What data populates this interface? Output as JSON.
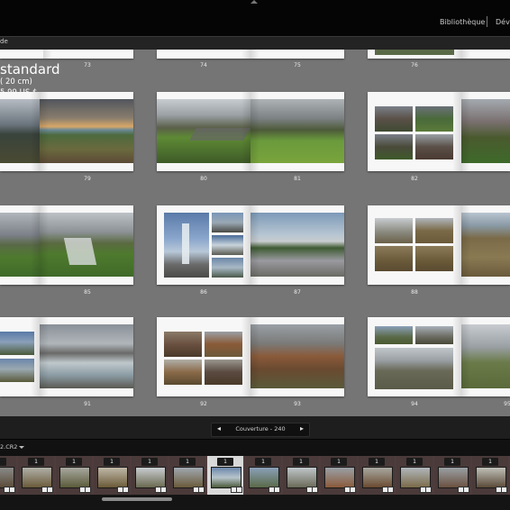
{
  "header": {
    "modules": [
      {
        "label": "Bibliothèque"
      },
      {
        "label": "Dév"
      }
    ]
  },
  "panel": {
    "label": "de"
  },
  "book": {
    "title": "standard",
    "size": "( 20 cm)",
    "price": "5,99 US $"
  },
  "spreads_row0": [
    {
      "left": "73",
      "right": ""
    },
    {
      "left": "74",
      "right": "75"
    },
    {
      "left": "76",
      "right": "77"
    }
  ],
  "spreads": [
    {
      "left": "",
      "right": "79"
    },
    {
      "left": "80",
      "right": "81"
    },
    {
      "left": "82",
      "right": "83"
    },
    {
      "left": "",
      "right": "85"
    },
    {
      "left": "86",
      "right": "87"
    },
    {
      "left": "88",
      "right": "89"
    },
    {
      "left": "",
      "right": "91"
    },
    {
      "left": "92",
      "right": "93"
    },
    {
      "left": "94",
      "right": "95"
    }
  ],
  "navigation": {
    "prev": "◂",
    "label": "Couverture - 240",
    "next": "▸"
  },
  "filmstrip": {
    "filename": "2.CR2",
    "badges": [
      "1",
      "1",
      "1",
      "1",
      "1",
      "1",
      "1",
      "1",
      "1",
      "1",
      "1",
      "1",
      "1",
      "1"
    ],
    "selected_index": 6
  },
  "colors": {
    "canvas": "#757575",
    "filmstrip": "#4f3c3d"
  },
  "icons": {
    "prev": "chevron-left-icon",
    "next": "chevron-right-icon",
    "filename_menu": "caret-down-icon"
  }
}
